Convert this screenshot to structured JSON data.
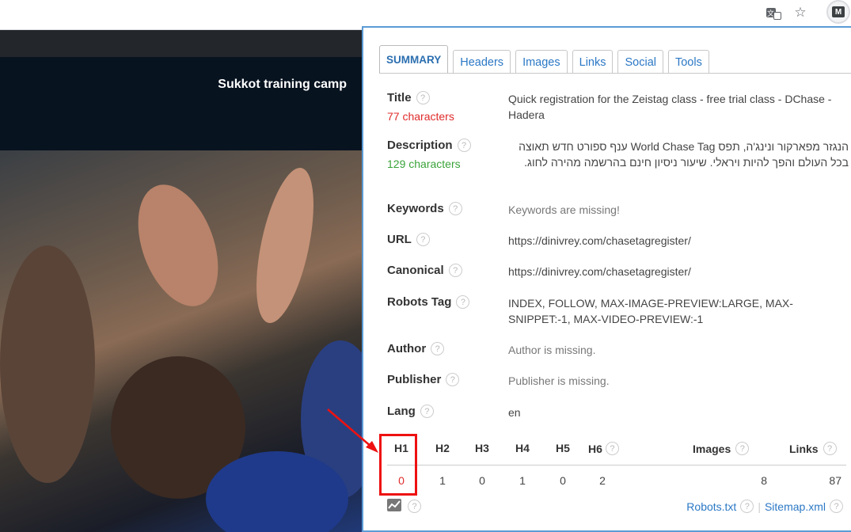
{
  "browser": {
    "star_glyph": "☆",
    "ext_glyph": "M",
    "translate_glyph": "文"
  },
  "page": {
    "hero_title": "Sukkot training camp"
  },
  "tabs": [
    "SUMMARY",
    "Headers",
    "Images",
    "Links",
    "Social",
    "Tools"
  ],
  "summary": {
    "title": {
      "label": "Title",
      "count": "77 characters",
      "value": "Quick registration for the Zeistag class - free trial class - DChase - Hadera"
    },
    "description": {
      "label": "Description",
      "count": "129 characters",
      "value": "הנגזר מפארקור ונינג'ה, תפס World Chase Tag ענף ספורט חדש תאוצה בכל העולם והפך להיות ויראלי. שיעור ניסיון חינם בהרשמה מהירה לחוג."
    },
    "keywords": {
      "label": "Keywords",
      "value": "Keywords are missing!"
    },
    "url": {
      "label": "URL",
      "value": "https://dinivrey.com/chasetagregister/"
    },
    "canonical": {
      "label": "Canonical",
      "value": "https://dinivrey.com/chasetagregister/"
    },
    "robots": {
      "label": "Robots Tag",
      "value": "INDEX, FOLLOW, MAX-IMAGE-PREVIEW:LARGE, MAX-SNIPPET:-1, MAX-VIDEO-PREVIEW:-1"
    },
    "author": {
      "label": "Author",
      "value": "Author is missing."
    },
    "publisher": {
      "label": "Publisher",
      "value": "Publisher is missing."
    },
    "lang": {
      "label": "Lang",
      "value": "en"
    }
  },
  "headings": {
    "labels": [
      "H1",
      "H2",
      "H3",
      "H4",
      "H5",
      "H6"
    ],
    "values": [
      "0",
      "1",
      "0",
      "1",
      "0",
      "2"
    ],
    "images_label": "Images",
    "images_value": "8",
    "links_label": "Links",
    "links_value": "87"
  },
  "footer": {
    "robots": "Robots.txt",
    "sitemap": "Sitemap.xml",
    "separator": "|"
  },
  "help_glyph": "?",
  "colors": {
    "tab_text": "#2b78c5",
    "warning": "#e02b2b",
    "ok": "#3aa33a",
    "highlight_box": "#ee1111"
  }
}
